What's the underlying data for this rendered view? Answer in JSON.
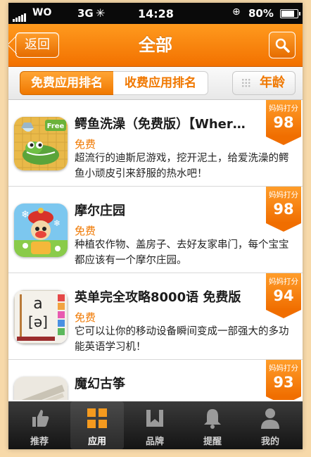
{
  "status_bar": {
    "carrier_logo": "WO",
    "network": "3G",
    "time": "14:28",
    "battery": "80%"
  },
  "nav": {
    "back_label": "返回",
    "title": "全部",
    "search_icon": "search-icon"
  },
  "segments": {
    "free_rank": "免费应用排名",
    "paid_rank": "收费应用排名",
    "age": "年龄"
  },
  "score_label": "妈妈打分",
  "apps": [
    {
      "name": "鳄鱼洗澡（免费版）【Wher…",
      "price": "免费",
      "desc": "超流行的迪斯尼游戏，挖开泥土，给爱洗澡的鳄鱼小顽皮引来舒服的热水吧！",
      "score": "98",
      "icon_badge": "Free"
    },
    {
      "name": "摩尔庄园",
      "price": "免费",
      "desc": "种植农作物、盖房子、去好友家串门，每个宝宝都应该有一个摩尔庄园。",
      "score": "98"
    },
    {
      "name": "英单完全攻略8000语 免费版",
      "price": "免费",
      "desc": "它可以让你的移动设备瞬间变成一部强大的多功能英语学习机！",
      "score": "94",
      "icon_letter": "a",
      "icon_phonetic": "[ə]"
    },
    {
      "name": "魔幻古筝",
      "price": "",
      "desc": "",
      "score": "93"
    }
  ],
  "tabs": [
    {
      "label": "推荐",
      "icon": "thumbs-up-icon"
    },
    {
      "label": "应用",
      "icon": "grid-icon"
    },
    {
      "label": "品牌",
      "icon": "brand-icon"
    },
    {
      "label": "提醒",
      "icon": "bell-icon"
    },
    {
      "label": "我的",
      "icon": "person-icon"
    }
  ],
  "colors": {
    "accent": "#f07800",
    "nav_bg": "#ff9a1e",
    "tabbar_bg": "#141414"
  }
}
